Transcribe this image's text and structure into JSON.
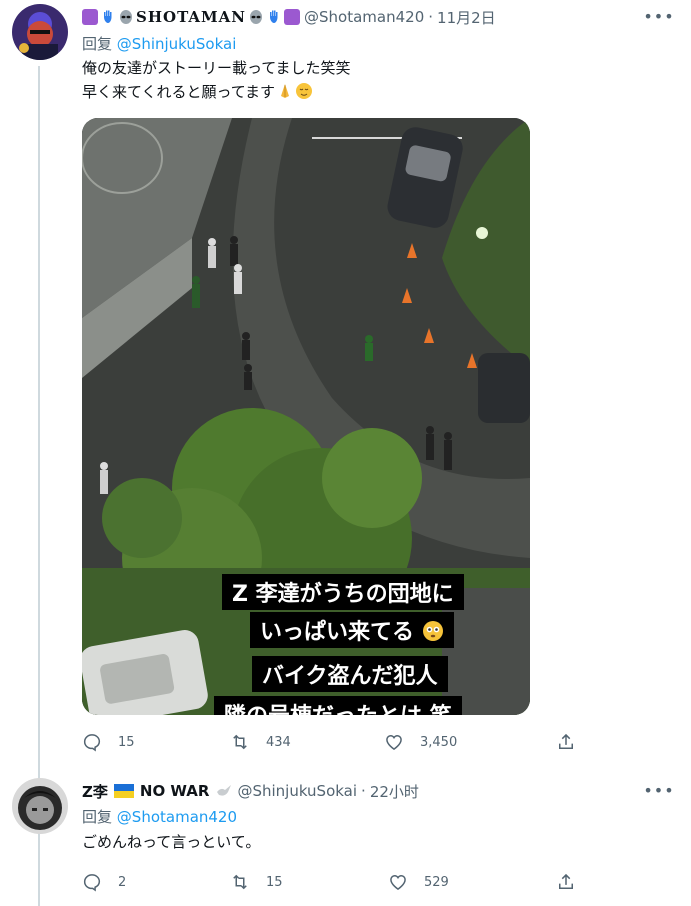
{
  "tweet1": {
    "display_name": "SHOTAMAN",
    "handle": "@Shotaman420",
    "time": "11月2日",
    "reply_prefix": "回复",
    "reply_mention": "@ShinjukuSokai",
    "text_line1": "俺の友達がストーリー載ってました笑笑",
    "text_line2": "早く来てくれると願ってます",
    "media_caption": {
      "line1": "Z 李達がうちの団地に",
      "line2": "いっぱい来てる",
      "line3": "バイク盗んだ犯人",
      "line4": "隣の号棟だったとは 笑"
    },
    "stats": {
      "replies": "15",
      "retweets": "434",
      "likes": "3,450"
    }
  },
  "tweet2": {
    "display_name": "Z李",
    "name_suffix": "NO WAR",
    "handle": "@ShinjukuSokai",
    "time": "22小时",
    "reply_prefix": "回复",
    "reply_mention": "@Shotaman420",
    "text": "ごめんねって言っといて。",
    "stats": {
      "replies": "2",
      "retweets": "15",
      "likes": "529"
    }
  },
  "colors": {
    "link": "#1d9bf0",
    "muted": "#536471",
    "text": "#0f1419",
    "divider": "#eff3f4"
  }
}
